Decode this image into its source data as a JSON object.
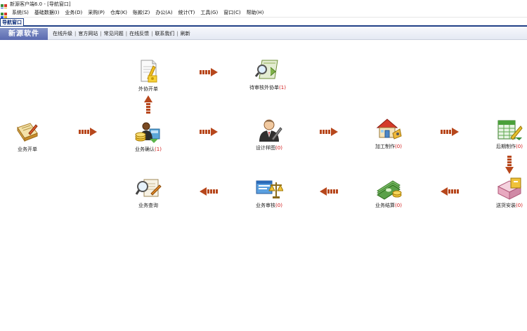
{
  "window": {
    "title": "新源客户端6.0 - [导航窗口]"
  },
  "menu": {
    "items": [
      "系统(S)",
      "基础数据(I)",
      "业务(D)",
      "采购(P)",
      "仓库(K)",
      "账款(Z)",
      "办公(A)",
      "统计(T)",
      "工具(G)",
      "窗口(C)",
      "帮助(H)"
    ]
  },
  "tab": {
    "label": "导航窗口"
  },
  "nav": {
    "brand": "新源软件",
    "links": [
      "在线升级",
      "官方网站",
      "常见问题",
      "在线反馈",
      "联系我们",
      "刷新"
    ],
    "separator": "|"
  },
  "workflow": {
    "nodes": [
      {
        "label": "外协开单",
        "count": "",
        "icon": "contract-pen-icon"
      },
      {
        "label": "待审核外协单",
        "count": "(1)",
        "icon": "approval-magnifier-icon"
      },
      {
        "label": "业务开单",
        "count": "",
        "icon": "order-book-icon"
      },
      {
        "label": "业务确认",
        "count": "(1)",
        "icon": "confirm-coins-icon"
      },
      {
        "label": "设计样图",
        "count": "(0)",
        "icon": "designer-person-icon"
      },
      {
        "label": "加工制作",
        "count": "(0)",
        "icon": "factory-house-icon"
      },
      {
        "label": "后期制作",
        "count": "(0)",
        "icon": "spreadsheet-tools-icon"
      },
      {
        "label": "业务查询",
        "count": "",
        "icon": "query-magnifier-icon"
      },
      {
        "label": "业务审核",
        "count": "(0)",
        "icon": "audit-scale-icon"
      },
      {
        "label": "业务结算",
        "count": "(0)",
        "icon": "money-stack-icon"
      },
      {
        "label": "送货安装",
        "count": "(0)",
        "icon": "delivery-box-icon"
      }
    ]
  },
  "colors": {
    "tab_border": "#1f3f86",
    "brand_bg": "#5a6ab0",
    "arrow": "#b7471c",
    "count": "#d01414"
  }
}
